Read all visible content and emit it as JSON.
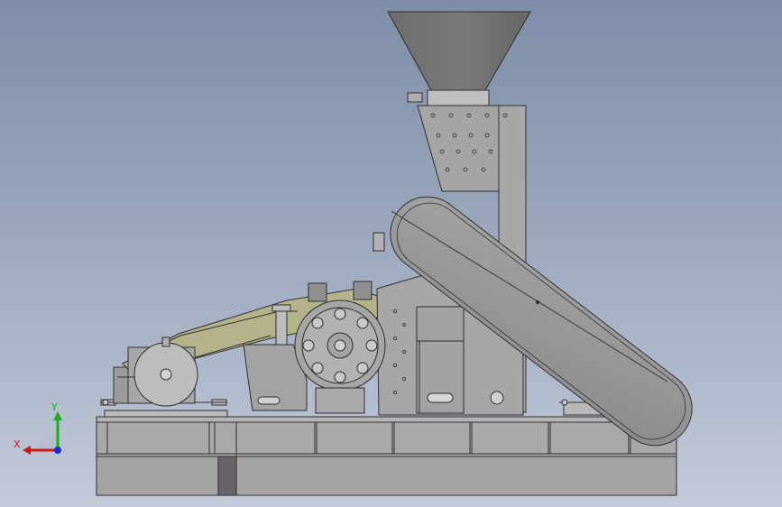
{
  "viewport": {
    "background_top": "#7d8ea8",
    "background_bottom": "#c3cad9"
  },
  "colors": {
    "frame": "#a9a9a9",
    "frame_dark": "#8e8e8e",
    "line": "#2f2f2f",
    "hopper": "#707070",
    "belt_guard": "#b5b38a",
    "column": "#cccccc",
    "axis_x": "#d01818",
    "axis_y": "#18b018",
    "axis_z": "#1c2cd0"
  },
  "triad": {
    "x_label": "X",
    "y_label": "Y",
    "x_icon": "axis-arrow-x",
    "y_icon": "axis-arrow-y",
    "z_icon": "axis-dot-z"
  }
}
